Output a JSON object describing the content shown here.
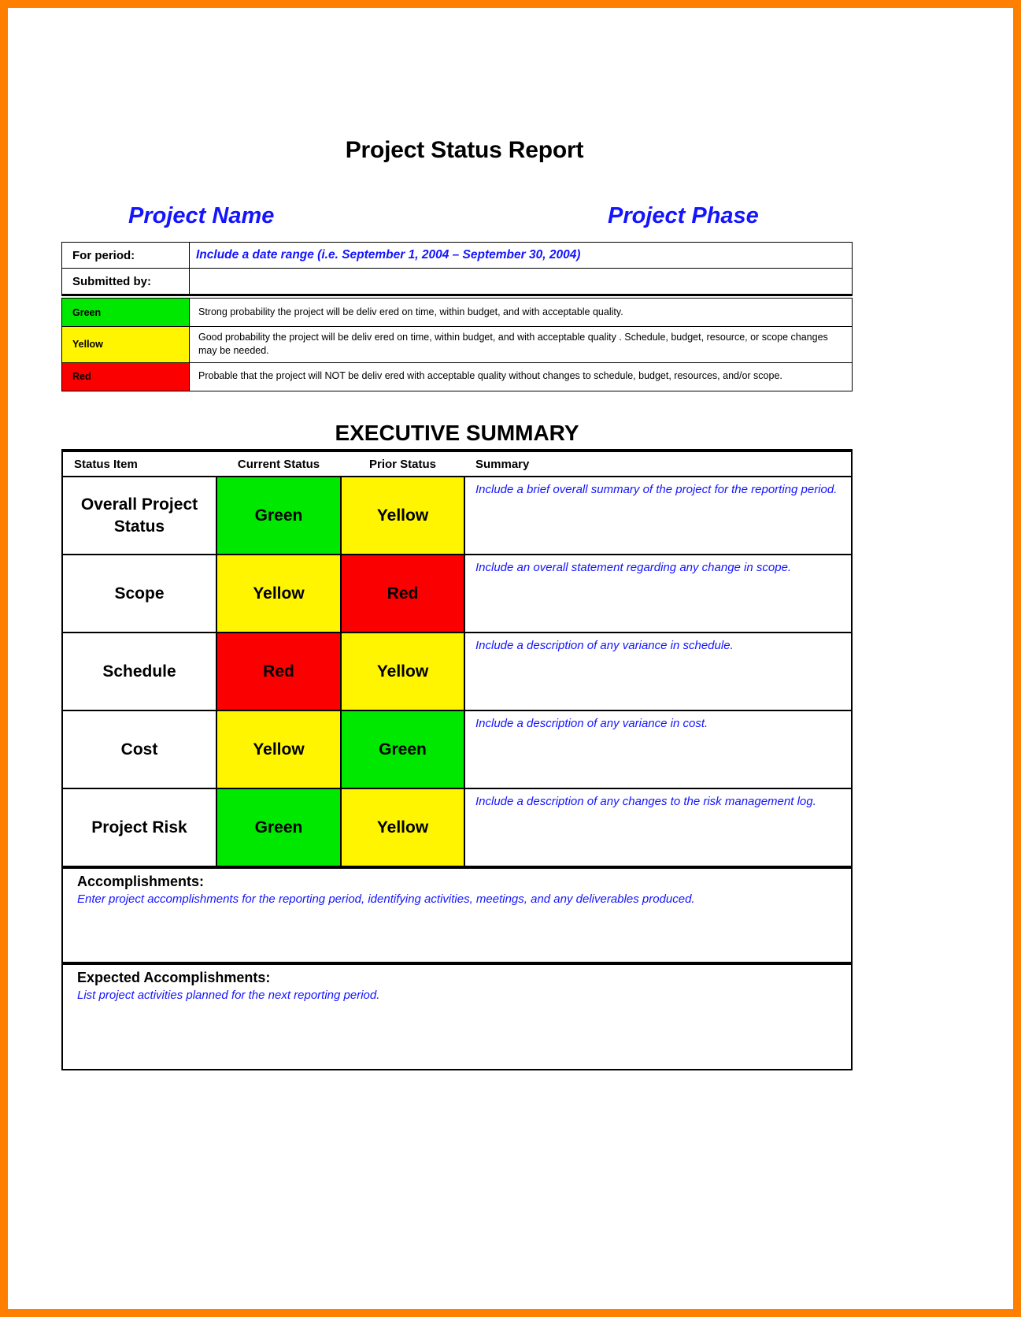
{
  "page": {
    "border_color": "#ff7f00",
    "background": "#ffffff"
  },
  "document": {
    "title": "Project Status Report",
    "project_name_label": "Project Name",
    "project_phase_label": "Project Phase"
  },
  "header_table": {
    "for_period_label": "For period:",
    "for_period_value": "Include a date range (i.e. September 1, 2004 – September 30, 2004)",
    "submitted_by_label": "Submitted by:",
    "submitted_by_value": ""
  },
  "legend": {
    "rows": [
      {
        "name": "Green",
        "color": "#00e800",
        "description": "Strong probability  the project will be deliv ered on time, within budget, and with acceptable quality."
      },
      {
        "name": "Yellow",
        "color": "#fff500",
        "description": "Good probability the project will be deliv ered on time, within budget, and with acceptable quality . Schedule, budget, resource, or scope changes may be needed."
      },
      {
        "name": "Red",
        "color": "#fa0000",
        "description": "Probable that the project will NOT be deliv ered with acceptable quality without changes to schedule, budget, resources, and/or scope."
      }
    ]
  },
  "executive_summary": {
    "section_title": "EXECUTIVE SUMMARY",
    "columns": [
      "Status Item",
      "Current Status",
      "Prior Status",
      "Summary"
    ],
    "rows": [
      {
        "item": "Overall Project Status",
        "current_status": "Green",
        "current_color": "#00e800",
        "prior_status": "Yellow",
        "prior_color": "#fff500",
        "summary": "Include a brief overall summary of the project for the reporting period."
      },
      {
        "item": "Scope",
        "current_status": "Yellow",
        "current_color": "#fff500",
        "prior_status": "Red",
        "prior_color": "#fa0000",
        "summary": "Include an overall statement regarding any change in scope."
      },
      {
        "item": "Schedule",
        "current_status": "Red",
        "current_color": "#fa0000",
        "prior_status": "Yellow",
        "prior_color": "#fff500",
        "summary": "Include a description of any variance in schedule."
      },
      {
        "item": "Cost",
        "current_status": "Yellow",
        "current_color": "#fff500",
        "prior_status": "Green",
        "prior_color": "#00e800",
        "summary": "Include a description of any variance in cost."
      },
      {
        "item": "Project Risk",
        "current_status": "Green",
        "current_color": "#00e800",
        "prior_status": "Yellow",
        "prior_color": "#fff500",
        "summary": "Include a description of any changes to the risk management log."
      }
    ],
    "accomplishments": {
      "heading": "Accomplishments:",
      "body": "Enter project accomplishments for the reporting period, identifying activities, meetings, and any deliverables produced."
    },
    "expected_accomplishments": {
      "heading": "Expected Accomplishments:",
      "body": "List project activities planned for the next reporting period."
    }
  }
}
